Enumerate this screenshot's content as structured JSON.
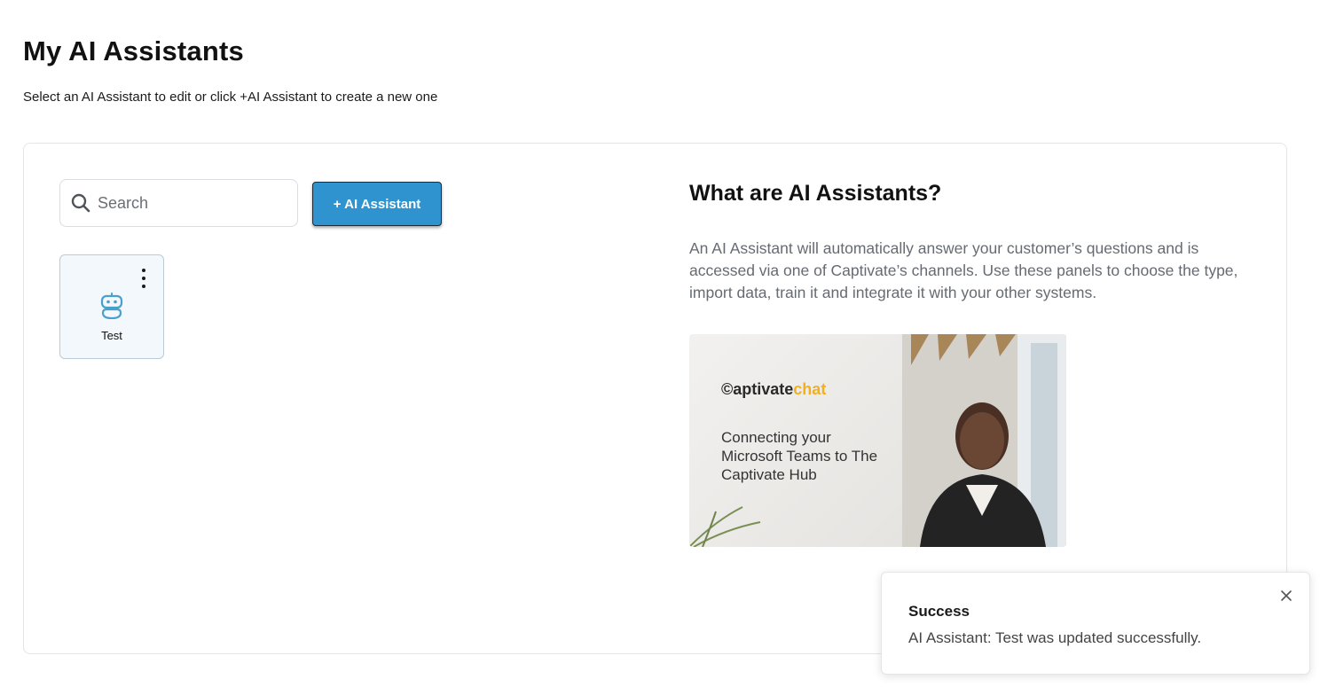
{
  "header": {
    "title": "My AI Assistants",
    "subtitle": "Select an AI Assistant to edit or click +AI Assistant to create a new one"
  },
  "toolbar": {
    "search_placeholder": "Search",
    "search_value": "",
    "add_label": "+ AI Assistant"
  },
  "assistants": [
    {
      "name": "Test",
      "icon": "robot-icon"
    }
  ],
  "info": {
    "title": "What are AI Assistants?",
    "description": "An AI Assistant will automatically answer your customer’s questions and is accessed via one of Captivate’s channels. Use these panels to choose the type, import data, train it and integrate it with your other systems.",
    "video": {
      "brand_prefix": "©aptivate",
      "brand_accent": "chat",
      "caption": "Connecting your Microsoft Teams to The Captivate Hub"
    }
  },
  "toast": {
    "title": "Success",
    "message": "AI Assistant: Test was updated successfully."
  },
  "colors": {
    "accent": "#2f93cf",
    "robot_icon": "#4a9fcb",
    "brand_accent": "#f2b01e"
  }
}
